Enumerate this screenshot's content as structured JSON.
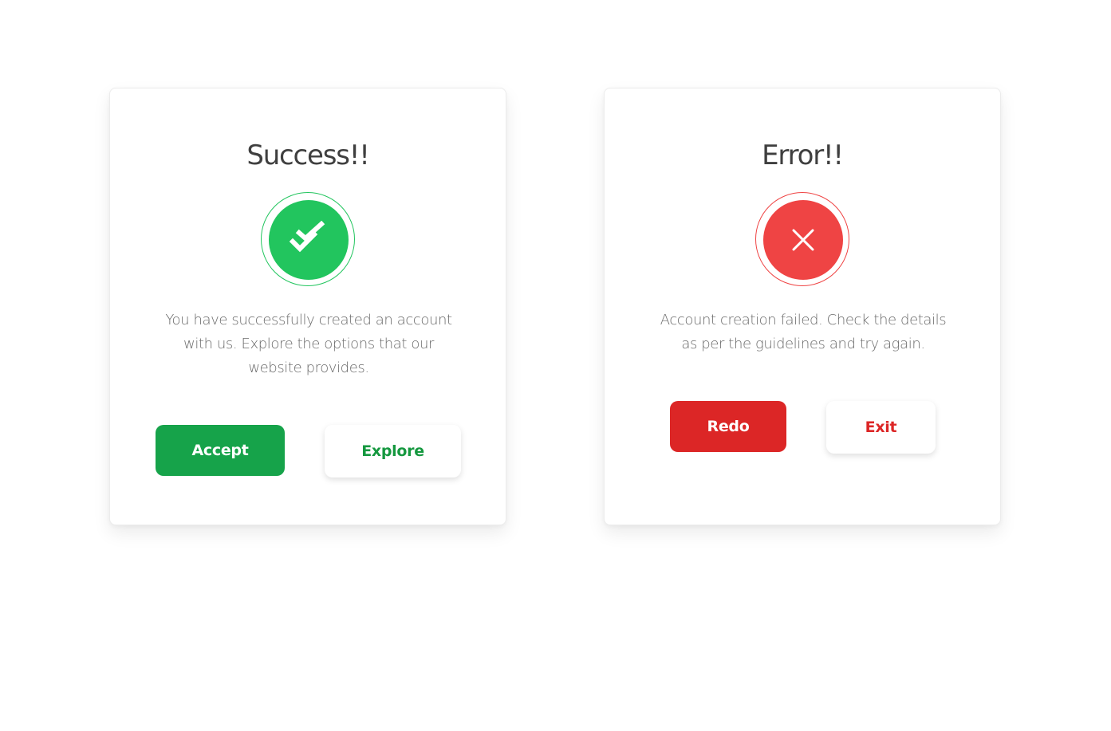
{
  "success_card": {
    "title": "Success!!",
    "icon": "double-check-icon",
    "message": "You have successfully created an account with us. Explore the options that our website provides.",
    "primary_label": "Accept",
    "secondary_label": "Explore",
    "accent_color": "#22c55e",
    "button_color": "#16a34a"
  },
  "error_card": {
    "title": "Error!!",
    "icon": "close-icon",
    "message": "Account creation failed. Check the details as per the guidelines and try again.",
    "primary_label": "Redo",
    "secondary_label": "Exit",
    "accent_color": "#ef4444",
    "button_color": "#dc2626"
  }
}
